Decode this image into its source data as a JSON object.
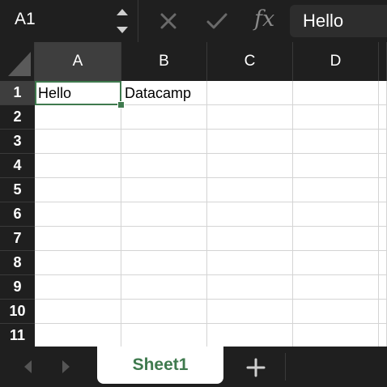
{
  "formula_bar": {
    "name_box": "A1",
    "fx_label": "fx",
    "formula_value": "Hello"
  },
  "grid": {
    "columns": [
      "A",
      "B",
      "C",
      "D"
    ],
    "rows": [
      "1",
      "2",
      "3",
      "4",
      "5",
      "6",
      "7",
      "8",
      "9",
      "10",
      "11"
    ],
    "cells": {
      "A1": "Hello",
      "B1": "Datacamp"
    },
    "active_cell": "A1"
  },
  "sheets": {
    "tabs": [
      "Sheet1"
    ],
    "active": "Sheet1"
  },
  "colors": {
    "accent_green": "#3f7a4e",
    "chrome_dark": "#1f1f1f",
    "header_selected": "#3e3e3e"
  },
  "icons": {
    "stepper": "up-down-stepper-icon",
    "cancel": "x-icon",
    "enter": "check-icon",
    "prev_sheet": "chevron-left-icon",
    "next_sheet": "chevron-right-icon",
    "add_sheet": "plus-icon"
  }
}
